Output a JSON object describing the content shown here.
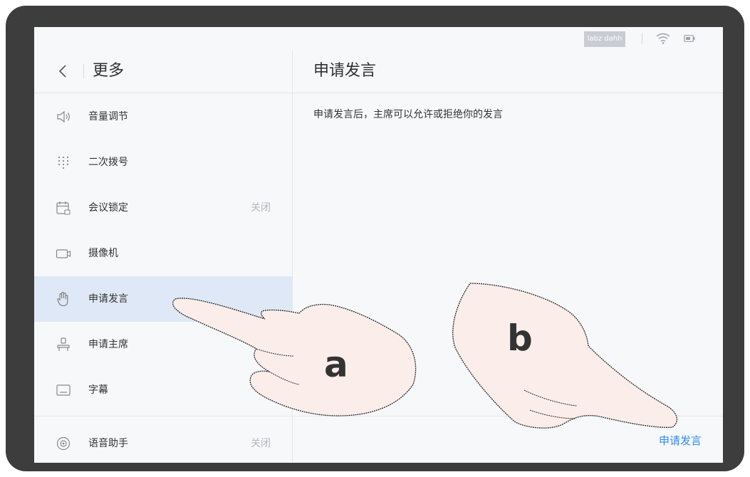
{
  "status_bar": {
    "user_name": "labz dahh"
  },
  "sidebar": {
    "title": "更多",
    "items": [
      {
        "label": "音量调节",
        "icon": "volume-icon",
        "value": ""
      },
      {
        "label": "二次拨号",
        "icon": "dialpad-icon",
        "value": ""
      },
      {
        "label": "会议锁定",
        "icon": "calendar-lock-icon",
        "value": "关闭"
      },
      {
        "label": "摄像机",
        "icon": "camera-icon",
        "value": ""
      },
      {
        "label": "申请发言",
        "icon": "hand-raise-icon",
        "value": "",
        "selected": true
      },
      {
        "label": "申请主席",
        "icon": "chair-icon",
        "value": ""
      },
      {
        "label": "字幕",
        "icon": "subtitle-icon",
        "value": ""
      },
      {
        "label": "语音助手",
        "icon": "voice-assistant-icon",
        "value": "关闭"
      }
    ]
  },
  "content": {
    "title": "申请发言",
    "description": "申请发言后，主席可以允许或拒绝你的发言",
    "action_button": "申请发言"
  },
  "annotations": {
    "hand_a": "a",
    "hand_b": "b"
  },
  "colors": {
    "accent": "#2d8cf0",
    "selected_bg": "#dfe8f6",
    "frame": "#3d3d3d"
  }
}
